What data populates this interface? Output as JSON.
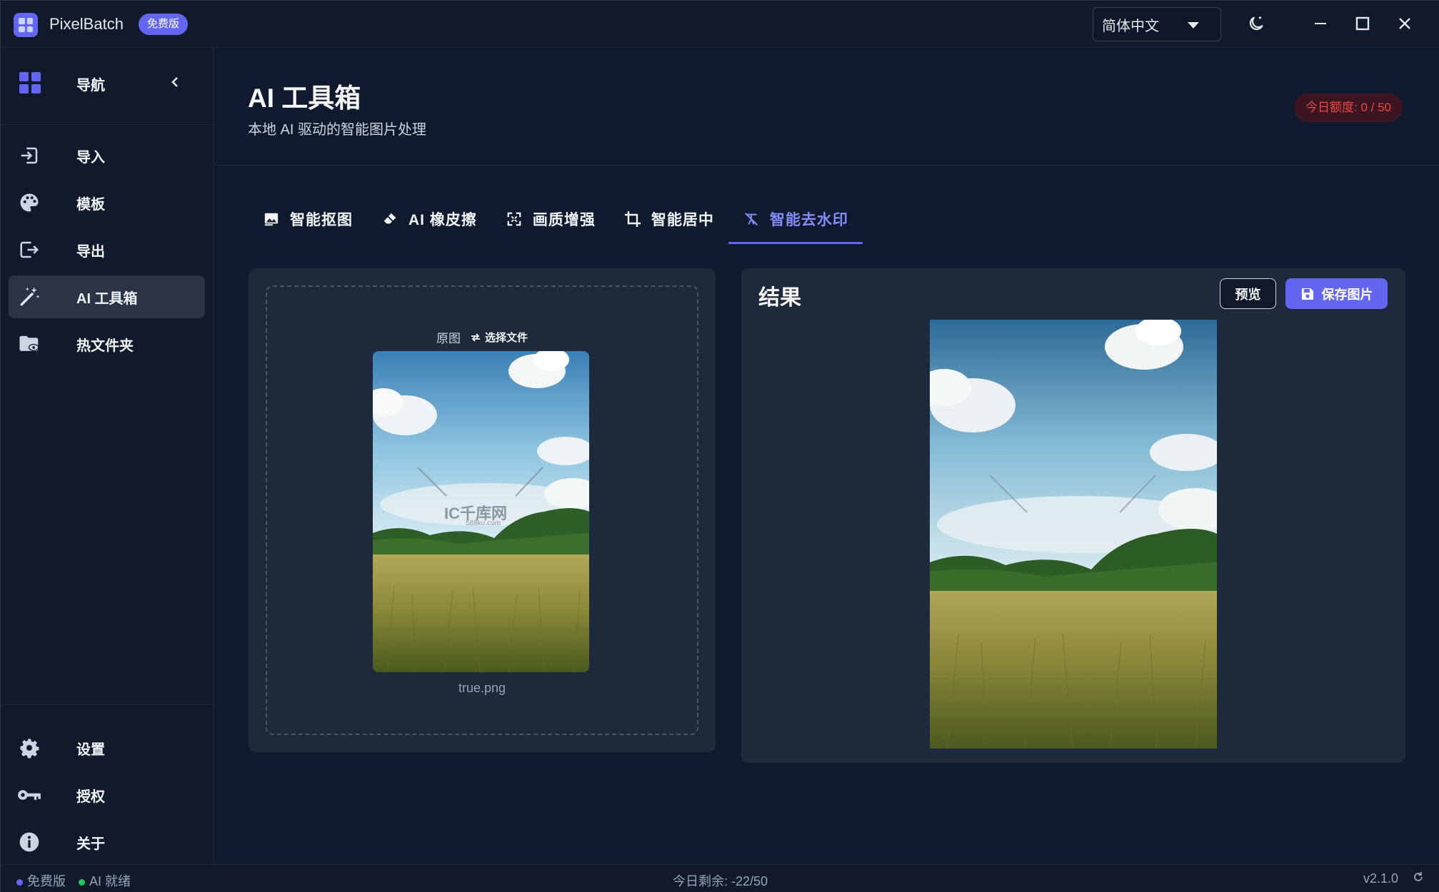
{
  "app": {
    "name": "PixelBatch",
    "badge": "免费版"
  },
  "titlebar": {
    "language": "简体中文"
  },
  "sidebar": {
    "nav_label": "导航",
    "items": [
      {
        "label": "导入",
        "icon": "import-icon"
      },
      {
        "label": "模板",
        "icon": "palette-icon"
      },
      {
        "label": "导出",
        "icon": "export-icon"
      },
      {
        "label": "AI 工具箱",
        "icon": "magic-wand-icon",
        "active": true
      },
      {
        "label": "热文件夹",
        "icon": "folder-eye-icon"
      }
    ],
    "bottom_items": [
      {
        "label": "设置",
        "icon": "gear-icon"
      },
      {
        "label": "授权",
        "icon": "key-icon"
      },
      {
        "label": "关于",
        "icon": "info-icon"
      }
    ]
  },
  "header": {
    "title": "AI 工具箱",
    "subtitle": "本地 AI 驱动的智能图片处理",
    "quota": "今日额度: 0 / 50"
  },
  "tabs": [
    {
      "label": "智能抠图",
      "icon": "image-cutout-icon"
    },
    {
      "label": "AI 橡皮擦",
      "icon": "eraser-icon"
    },
    {
      "label": "画质增强",
      "icon": "enhance-icon"
    },
    {
      "label": "智能居中",
      "icon": "crop-icon"
    },
    {
      "label": "智能去水印",
      "icon": "remove-watermark-icon",
      "active": true
    }
  ],
  "source": {
    "label": "原图",
    "select_file": "选择文件",
    "file_name": "true.png",
    "watermark_text": "IC千库网",
    "watermark_sub": "588ku.com"
  },
  "result": {
    "title": "结果",
    "preview_label": "预览",
    "save_label": "保存图片"
  },
  "statusbar": {
    "plan": "免费版",
    "ai_status": "AI 就绪",
    "remaining": "今日剩余: -22/50",
    "version": "v2.1.0"
  },
  "colors": {
    "accent": "#6366f1",
    "background": "#101a2e",
    "panel": "#1e293b",
    "danger": "#ef4444",
    "ready": "#22c55e"
  }
}
